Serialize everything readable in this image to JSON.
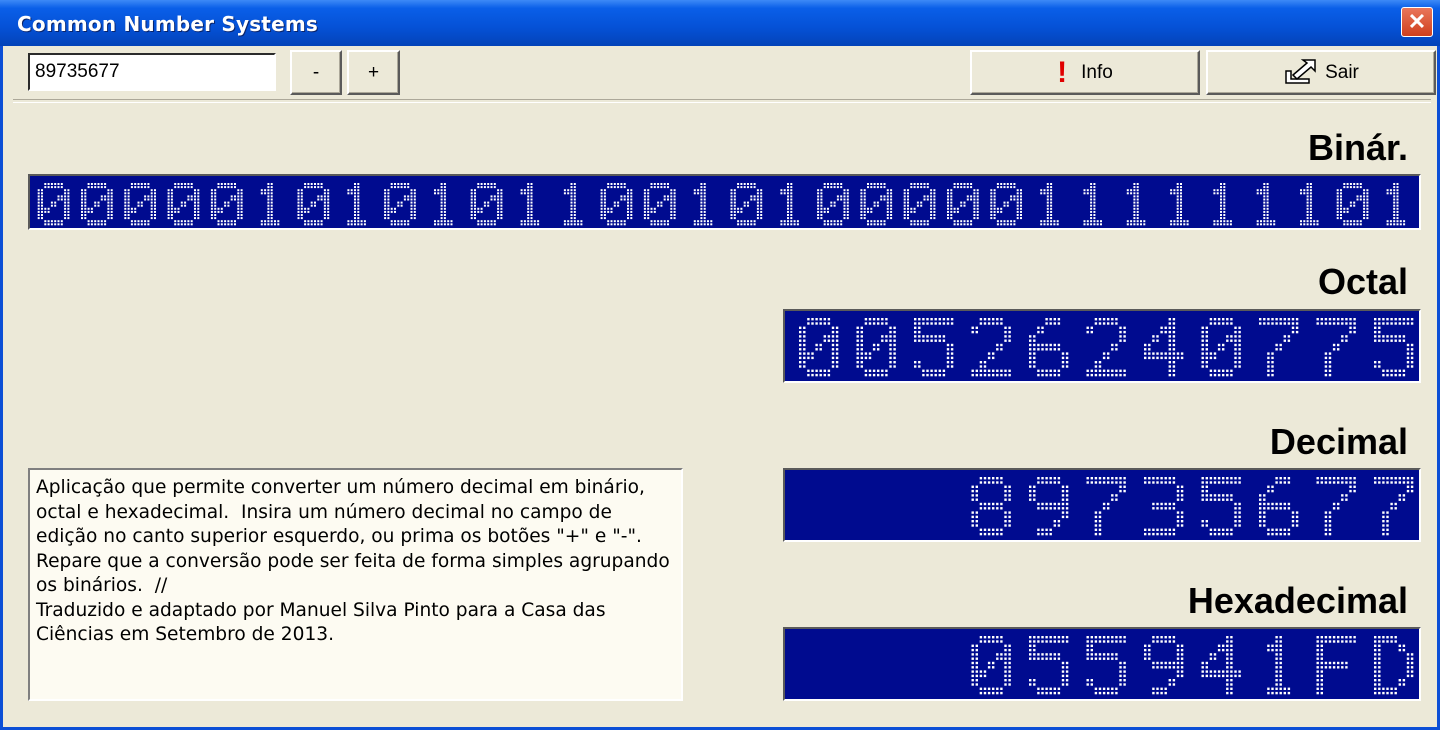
{
  "window": {
    "title": "Common Number Systems",
    "close_symbol": "✕"
  },
  "toolbar": {
    "input_value": "89735677",
    "minus_label": "-",
    "plus_label": "+",
    "info_label": "Info",
    "sair_label": "Sair"
  },
  "displays": {
    "binary": {
      "label": "Binár.",
      "value": "00000101010110010100000111111101"
    },
    "octal": {
      "label": "Octal",
      "value": "00526240775"
    },
    "decimal": {
      "label": "Decimal",
      "value": "89735677"
    },
    "hex": {
      "label": "Hexadecimal",
      "value": "055941FD"
    }
  },
  "description": "Aplicação que permite converter um número decimal em binário, octal e hexadecimal.  Insira um número decimal no campo de edição no canto superior esquerdo, ou prima os botões \"+\" e \"-\".  Repare que a conversão pode ser feita de forma simples agrupando os binários.  //\nTraduzido e adaptado por Manuel Silva Pinto para a Casa das Ciências em Setembro de 2013.",
  "colors": {
    "display_bg": "#000b8f",
    "dot": "#ffffff",
    "title_bar": "#0551d6"
  }
}
